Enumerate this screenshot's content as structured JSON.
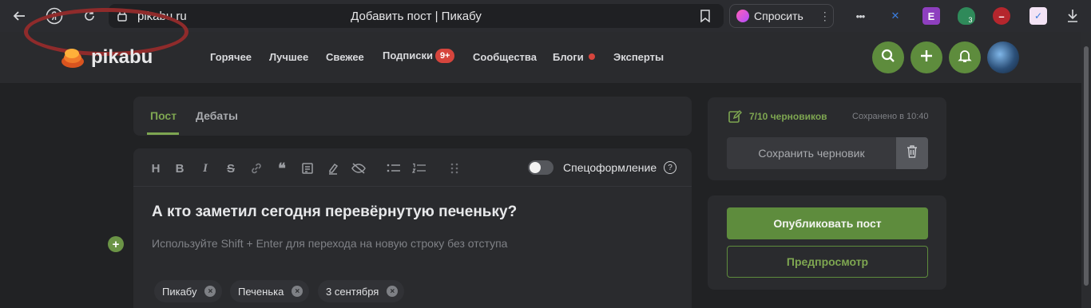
{
  "browser": {
    "url": "pikabu.ru",
    "tab_title": "Добавить пост | Пикабу",
    "ask_label": "Спросить",
    "ext_badge_count": "3"
  },
  "site": {
    "logo_text": "pikabu",
    "nav": {
      "hot": "Горячее",
      "best": "Лучшее",
      "fresh": "Свежее",
      "subscriptions": "Подписки",
      "subscriptions_badge": "9+",
      "communities": "Сообщества",
      "blogs": "Блоги",
      "experts": "Эксперты"
    }
  },
  "editor": {
    "tabs": {
      "post": "Пост",
      "debates": "Дебаты"
    },
    "spec_label": "Спецоформление",
    "help": "?",
    "title": "А кто заметил сегодня перевёрнутую печеньку?",
    "placeholder": "Используйте Shift + Enter для перехода на новую строку без отступа",
    "add": "+",
    "tags": [
      "Пикабу",
      "Печенька",
      "3 сентября"
    ],
    "tag_remove": "×",
    "toolbar": {
      "heading": "H",
      "bold": "B",
      "italic": "I",
      "strike": "S",
      "quote": "❝"
    }
  },
  "sidebar": {
    "drafts_count": "7/10 черновиков",
    "saved_time": "Сохранено в 10:40",
    "save_draft": "Сохранить черновик",
    "publish": "Опубликовать пост",
    "preview": "Предпросмотр"
  },
  "colors": {
    "accent": "#5e8c3d",
    "accent_text": "#7ea651",
    "badge": "#d6453d",
    "background": "#212224",
    "card": "#2a2b2e"
  }
}
